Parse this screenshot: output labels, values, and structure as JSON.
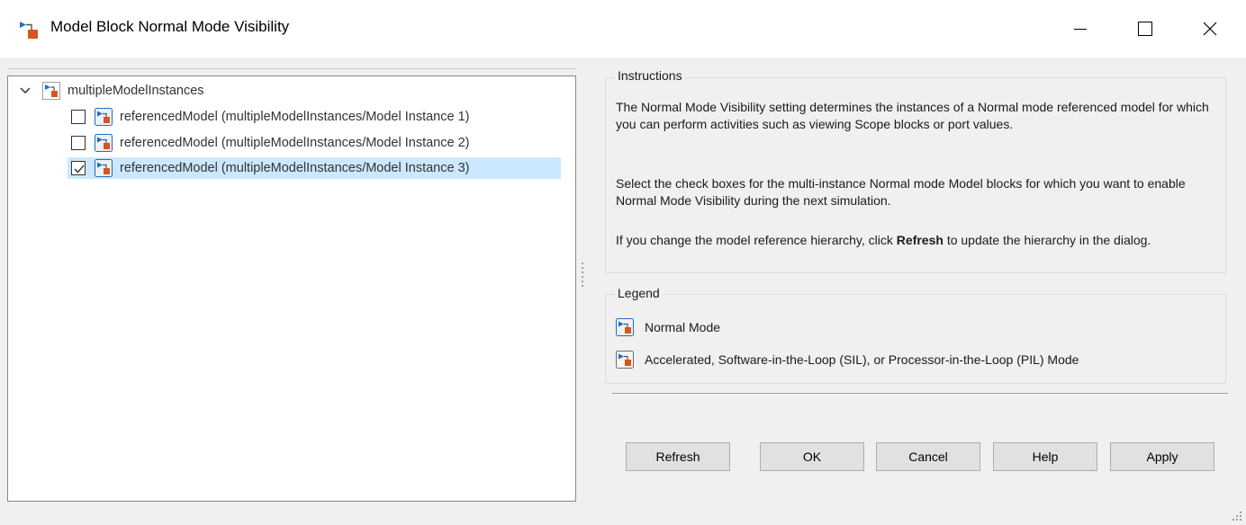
{
  "window": {
    "title": "Model Block Normal Mode Visibility",
    "controls": [
      "minimize",
      "maximize",
      "close"
    ]
  },
  "tree": {
    "root": {
      "label": "multipleModelInstances",
      "expanded": true,
      "icon": "model-root-icon"
    },
    "children": [
      {
        "label": "referencedModel (multipleModelInstances/Model Instance 1)",
        "checked": false,
        "selected": false,
        "icon": "normal-mode-model-icon"
      },
      {
        "label": "referencedModel (multipleModelInstances/Model Instance 2)",
        "checked": false,
        "selected": false,
        "icon": "normal-mode-model-icon"
      },
      {
        "label": "referencedModel (multipleModelInstances/Model Instance 3)",
        "checked": true,
        "selected": true,
        "icon": "normal-mode-model-icon"
      }
    ]
  },
  "instructions": {
    "title": "Instructions",
    "p1": "The Normal Mode Visibility setting determines the instances of a Normal mode referenced model for which you can perform activities such as viewing Scope blocks or port values.",
    "p2": "Select the check boxes for the multi-instance Normal mode Model blocks for which you want to enable Normal Mode Visibility during the next simulation.",
    "p3_before": "If you change the model reference hierarchy, click ",
    "p3_bold": "Refresh",
    "p3_after": " to update the hierarchy in the dialog."
  },
  "legend": {
    "title": "Legend",
    "items": [
      {
        "label": "Normal Mode",
        "icon": "normal-mode-icon"
      },
      {
        "label": "Accelerated, Software-in-the-Loop (SIL), or Processor-in-the-Loop (PIL) Mode",
        "icon": "accelerated-mode-icon"
      }
    ]
  },
  "buttons": {
    "refresh": "Refresh",
    "ok": "OK",
    "cancel": "Cancel",
    "help": "Help",
    "apply": "Apply"
  },
  "colors": {
    "selection": "#cce8ff",
    "model_orange": "#d9541e",
    "model_blue": "#1f6fbf"
  }
}
